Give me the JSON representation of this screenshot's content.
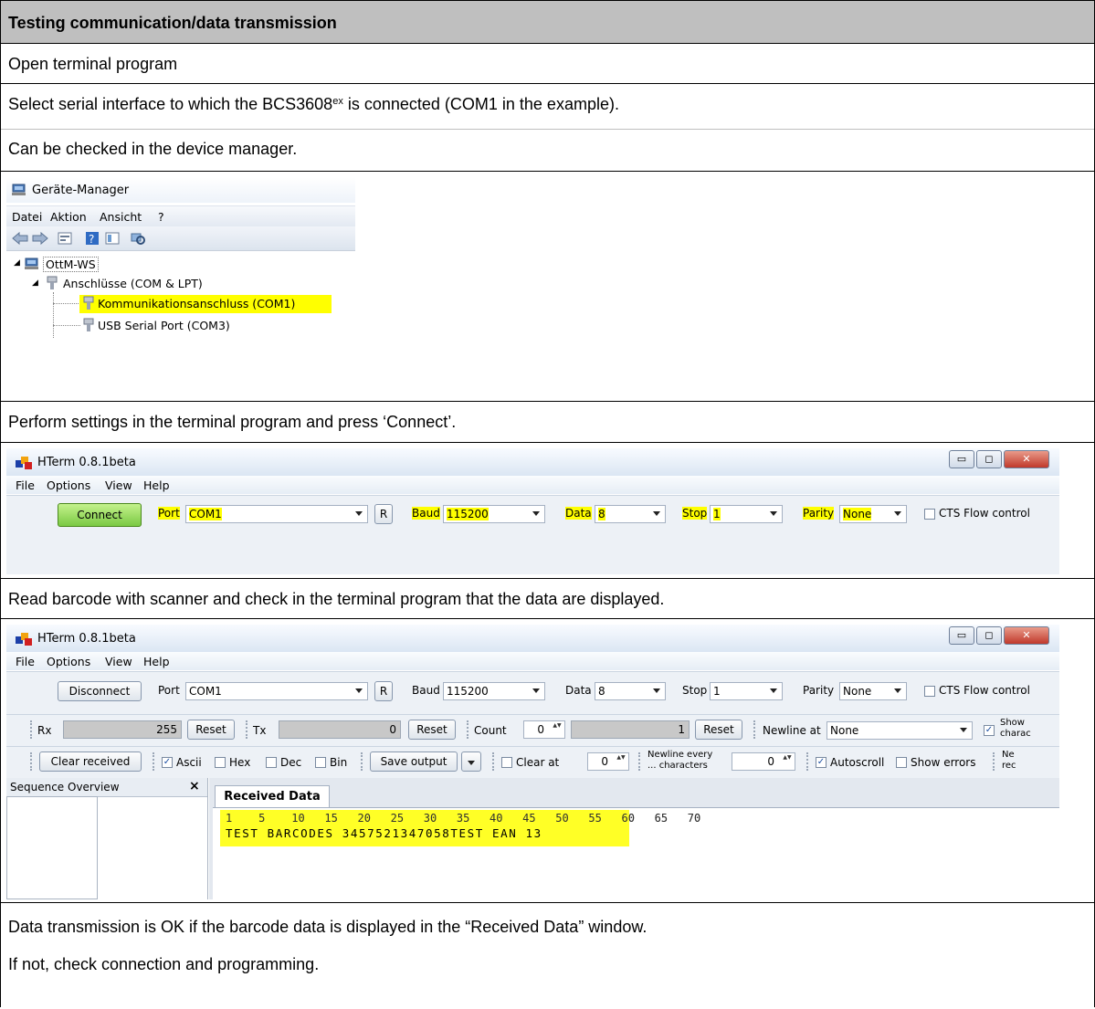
{
  "header": {
    "title": "Testing communication/data transmission"
  },
  "steps": {
    "open_terminal": "Open terminal program",
    "select_interface_pre": "Select serial interface to which the BCS3608",
    "select_interface_sup": "ex",
    "select_interface_post": " is connected (COM1 in the example).",
    "device_manager_hint": "Can be checked in the device manager.",
    "perform_settings": "Perform settings in the terminal program and press ‘Connect’.",
    "read_barcode": "Read barcode with scanner and check in the terminal program that the data are displayed.",
    "result_ok": "Data transmission is OK if the barcode data is displayed in the “Received Data” window.",
    "result_fail": "If not, check connection and programming."
  },
  "device_manager": {
    "title": "Geräte-Manager",
    "menu": [
      "Datei",
      "Aktion",
      "Ansicht",
      "?"
    ],
    "tree": {
      "root": "OttM-WS",
      "group": "Anschlüsse (COM & LPT)",
      "item_selected": "Kommunikationsanschluss (COM1)",
      "item_other": "USB Serial Port (COM3)"
    }
  },
  "hterm1": {
    "title": "HTerm 0.8.1beta",
    "menu": [
      "File",
      "Options",
      "View",
      "Help"
    ],
    "connect_label": "Connect",
    "port_label": "Port",
    "port_value": "COM1",
    "r_label": "R",
    "baud_label": "Baud",
    "baud_value": "115200",
    "data_label": "Data",
    "data_value": "8",
    "stop_label": "Stop",
    "stop_value": "1",
    "parity_label": "Parity",
    "parity_value": "None",
    "cts_label": "CTS Flow control",
    "cts_checked": false
  },
  "hterm2": {
    "title": "HTerm 0.8.1beta",
    "menu": [
      "File",
      "Options",
      "View",
      "Help"
    ],
    "disconnect_label": "Disconnect",
    "port_label": "Port",
    "port_value": "COM1",
    "r_label": "R",
    "baud_label": "Baud",
    "baud_value": "115200",
    "data_label": "Data",
    "data_value": "8",
    "stop_label": "Stop",
    "stop_value": "1",
    "parity_label": "Parity",
    "parity_value": "None",
    "cts_label": "CTS Flow control",
    "rx_label": "Rx",
    "rx_value": "255",
    "reset_label": "Reset",
    "tx_label": "Tx",
    "tx_value": "0",
    "count_label": "Count",
    "count_value": "0",
    "count_field_value": "1",
    "newline_label": "Newline at",
    "newline_value": "None",
    "show_chars_label_1": "Show",
    "show_chars_label_2": "charac",
    "clear_received_label": "Clear received",
    "ascii_label": "Ascii",
    "hex_label": "Hex",
    "dec_label": "Dec",
    "bin_label": "Bin",
    "save_output_label": "Save output",
    "clear_at_label": "Clear at",
    "clear_at_value": "0",
    "newline_every_1": "Newline every",
    "newline_every_2": "... characters",
    "newline_every_value": "0",
    "autoscroll_label": "Autoscroll",
    "show_errors_label": "Show errors",
    "ne_label_1": "Ne",
    "ne_label_2": "rec",
    "sequence_overview_label": "Sequence Overview",
    "close_x": "×",
    "received_tab_label": "Received Data",
    "ruler": "1    5    10   15   20   25   30   35   40   45   50   55   60   65   70",
    "received_text": "TEST BARCODES 3457521347058TEST EAN 13"
  }
}
